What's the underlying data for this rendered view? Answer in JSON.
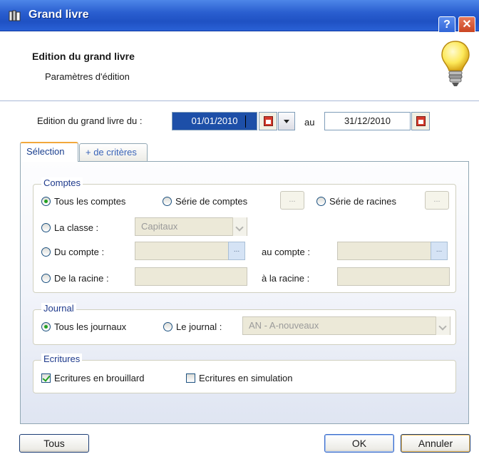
{
  "window": {
    "title": "Grand livre",
    "help_label": "?",
    "close_label": "✕"
  },
  "header": {
    "title": "Edition du grand livre",
    "subtitle": "Paramètres d'édition"
  },
  "period": {
    "label": "Edition du grand livre du :",
    "from": "01/01/2010",
    "to_label": "au",
    "to": "31/12/2010"
  },
  "tabs": [
    {
      "label": "Sélection",
      "active": true
    },
    {
      "label": "+ de critères",
      "active": false
    }
  ],
  "comptes": {
    "legend": "Comptes",
    "tous": "Tous les comptes",
    "serie_comptes": "Série de comptes",
    "serie_racines": "Série de racines",
    "classe": "La classe :",
    "classe_value": "Capitaux",
    "du_compte": "Du compte :",
    "au_compte": "au compte :",
    "de_racine": "De la racine :",
    "a_racine": "à la racine :",
    "ellipsis": "..."
  },
  "journal": {
    "legend": "Journal",
    "tous": "Tous les journaux",
    "le_journal": "Le journal :",
    "journal_value": "AN - A-nouveaux"
  },
  "ecritures": {
    "legend": "Ecritures",
    "brouillard": "Ecritures en brouillard",
    "simulation": "Ecritures en simulation"
  },
  "buttons": {
    "tous": "Tous",
    "ok": "OK",
    "annuler": "Annuler"
  },
  "icons": {
    "title": "book-icon",
    "header": "lightbulb-icon",
    "calendar": "calendar-icon"
  },
  "colors": {
    "titlebar": "#2a5fd0",
    "selection": "#1d4fa8",
    "legend": "#1e3a8c"
  }
}
